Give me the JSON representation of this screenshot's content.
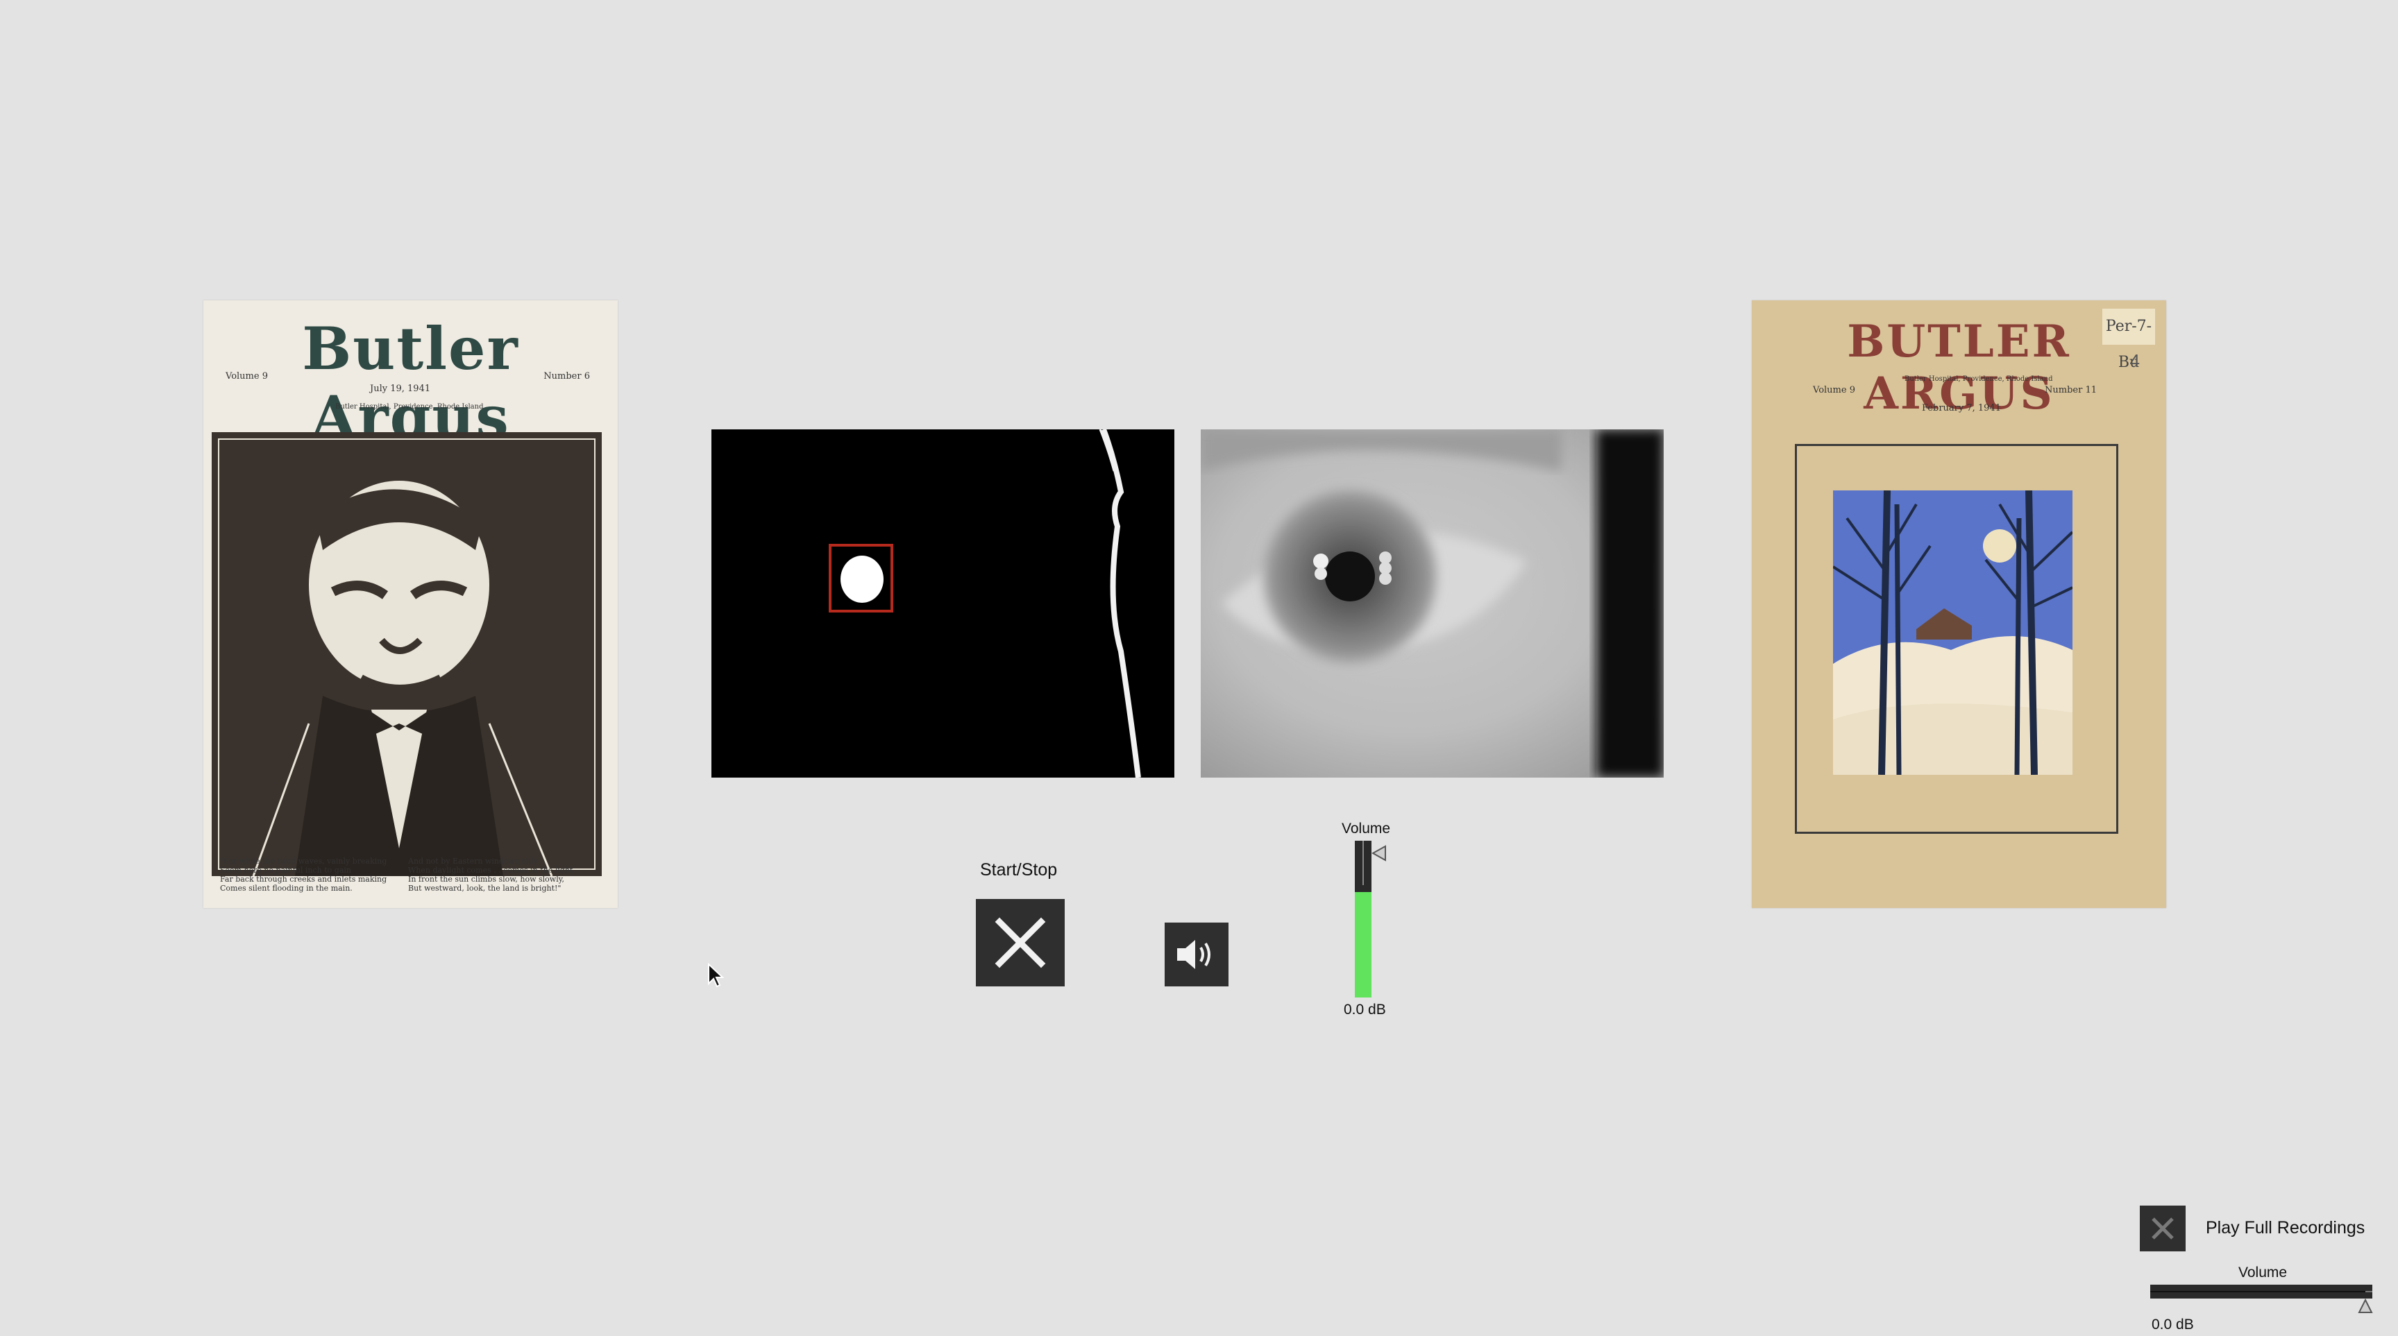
{
  "covers": {
    "left": {
      "masthead": "Butler Argus",
      "volume": "Volume 9",
      "date": "July 19, 1941",
      "number": "Number 6",
      "subline": "Butler Hospital, Providence, Rhode Island",
      "poem_left": [
        "\"For while the tired waves, vainly breaking",
        "Seem here no painful inch to gain",
        "Far back through creeks and inlets making",
        "Comes silent flooding in the main."
      ],
      "poem_right": [
        "And not by Eastern windows only,",
        "When daylight comes . . comes in the light",
        "In front the sun climbs slow, how slowly,",
        "But westward, look, the land is bright!\""
      ]
    },
    "right": {
      "masthead": "BUTLER ARGUS",
      "volume": "Volume 9",
      "date": "February 7, 1941",
      "number": "Number 11",
      "subline": "Butler Hospital, Providence, Rhode Island",
      "handwritten": "Per-7-Bu",
      "handwritten_num": "4"
    }
  },
  "controls": {
    "start_stop_label": "Start/Stop",
    "volume_label": "Volume",
    "volume_db": "0.0 dB",
    "volume_level": 0.86
  },
  "bottom": {
    "play_full_label": "Play Full Recordings",
    "volume_label": "Volume",
    "volume_db": "0.0 dB",
    "volume_level": 0.97
  },
  "colors": {
    "background": "#e3e3e3",
    "button_dark": "#2f2f2f",
    "meter_green": "#62e35e",
    "roi_box": "#b52a1c"
  },
  "icons": {
    "start_stop": "close-x-icon",
    "speaker": "speaker-icon",
    "play_full": "close-x-icon",
    "cursor": "mouse-pointer-icon"
  }
}
